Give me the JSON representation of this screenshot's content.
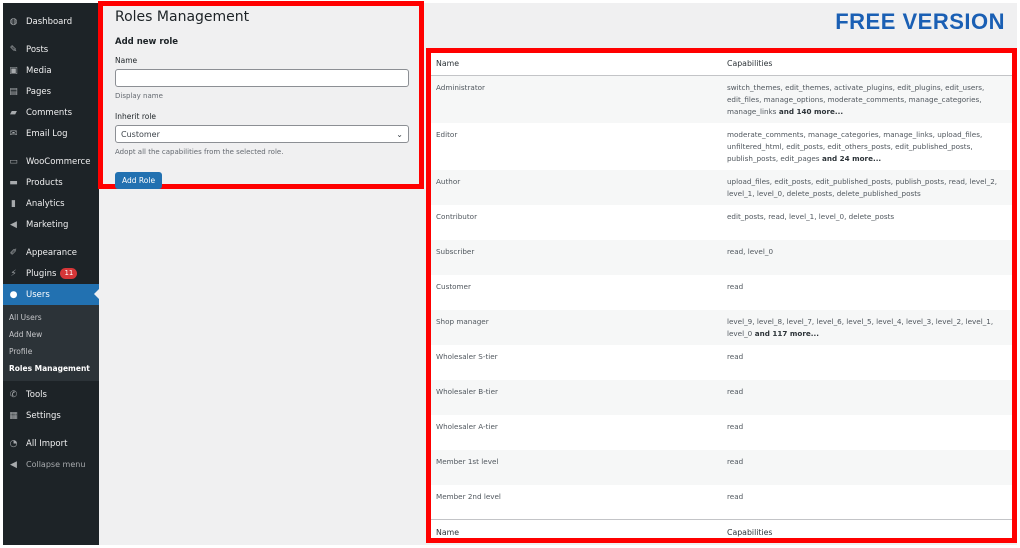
{
  "sidebar": {
    "items": [
      {
        "label": "Dashboard",
        "icon": "dashboard-icon"
      },
      {
        "label": "Posts",
        "icon": "pin-icon"
      },
      {
        "label": "Media",
        "icon": "media-icon"
      },
      {
        "label": "Pages",
        "icon": "pages-icon"
      },
      {
        "label": "Comments",
        "icon": "comment-icon"
      },
      {
        "label": "Email Log",
        "icon": "email-icon"
      },
      {
        "label": "WooCommerce",
        "icon": "woo-icon"
      },
      {
        "label": "Products",
        "icon": "products-icon"
      },
      {
        "label": "Analytics",
        "icon": "analytics-icon"
      },
      {
        "label": "Marketing",
        "icon": "megaphone-icon"
      },
      {
        "label": "Appearance",
        "icon": "brush-icon"
      },
      {
        "label": "Plugins",
        "icon": "plugin-icon",
        "badge": "11"
      },
      {
        "label": "Users",
        "icon": "user-icon"
      },
      {
        "label": "Tools",
        "icon": "wrench-icon"
      },
      {
        "label": "Settings",
        "icon": "settings-icon"
      },
      {
        "label": "All Import",
        "icon": "import-icon"
      },
      {
        "label": "Collapse menu",
        "icon": "collapse-icon"
      }
    ],
    "submenu": [
      "All Users",
      "Add New",
      "Profile",
      "Roles Management"
    ]
  },
  "page": {
    "title": "Roles Management",
    "free_badge": "FREE VERSION"
  },
  "form": {
    "heading": "Add new role",
    "name_label": "Name",
    "name_value": "",
    "name_desc": "Display name",
    "inherit_label": "Inherit role",
    "inherit_value": "Customer",
    "inherit_desc": "Adopt all the capabilities from the selected role.",
    "submit": "Add Role"
  },
  "table": {
    "headers": [
      "Name",
      "Capabilities"
    ],
    "rows": [
      {
        "name": "Administrator",
        "caps": "switch_themes, edit_themes, activate_plugins, edit_plugins, edit_users, edit_files, manage_options, moderate_comments, manage_categories, manage_links",
        "more": " and 140 more..."
      },
      {
        "name": "Editor",
        "caps": "moderate_comments, manage_categories, manage_links, upload_files, unfiltered_html, edit_posts, edit_others_posts, edit_published_posts, publish_posts, edit_pages",
        "more": " and 24 more..."
      },
      {
        "name": "Author",
        "caps": "upload_files, edit_posts, edit_published_posts, publish_posts, read, level_2, level_1, level_0, delete_posts, delete_published_posts",
        "more": ""
      },
      {
        "name": "Contributor",
        "caps": "edit_posts, read, level_1, level_0, delete_posts",
        "more": ""
      },
      {
        "name": "Subscriber",
        "caps": "read, level_0",
        "more": ""
      },
      {
        "name": "Customer",
        "caps": "read",
        "more": ""
      },
      {
        "name": "Shop manager",
        "caps": "level_9, level_8, level_7, level_6, level_5, level_4, level_3, level_2, level_1, level_0",
        "more": " and 117 more..."
      },
      {
        "name": "Wholesaler S-tier",
        "caps": "read",
        "more": ""
      },
      {
        "name": "Wholesaler B-tier",
        "caps": "read",
        "more": ""
      },
      {
        "name": "Wholesaler A-tier",
        "caps": "read",
        "more": ""
      },
      {
        "name": "Member 1st level",
        "caps": "read",
        "more": ""
      },
      {
        "name": "Member 2nd level",
        "caps": "read",
        "more": ""
      }
    ]
  }
}
